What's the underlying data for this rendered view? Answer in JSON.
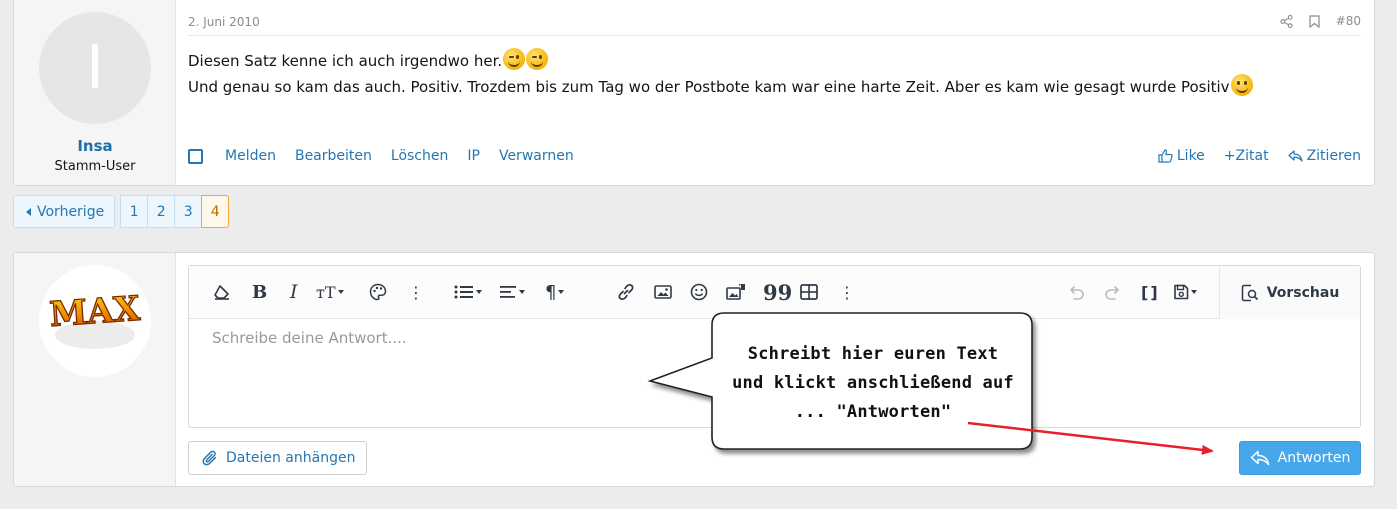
{
  "post": {
    "avatar_letter": "I",
    "username": "Insa",
    "user_title": "Stamm-User",
    "date": "2. Juni 2010",
    "number": "#80",
    "body_line1": "Diesen Satz kenne ich auch irgendwo her.",
    "body_line2": "Und genau so kam das auch. Positiv. Trozdem bis zum Tag wo der Postbote kam war eine harte Zeit. Aber es kam wie gesagt wurde Positiv",
    "actions": [
      "Melden",
      "Bearbeiten",
      "Löschen",
      "IP",
      "Verwarnen"
    ],
    "like_label": "Like",
    "quote_label": "+Zitat",
    "reply_quote_label": "Zitieren"
  },
  "pagination": {
    "prev_label": "Vorherige",
    "pages": [
      "1",
      "2",
      "3",
      "4"
    ],
    "current_page": "4"
  },
  "reply": {
    "avatar_text": "MAX",
    "placeholder": "Schreibe deine Antwort....",
    "preview_label": "Vorschau",
    "attach_label": "Dateien anhängen",
    "submit_label": "Antworten"
  },
  "callout": {
    "line1": "Schreibt hier euren Text",
    "line2": "und klickt anschließend auf",
    "line3": "... \"Antworten\""
  },
  "colors": {
    "link": "#2577b1",
    "submit_bg": "#47a7eb",
    "current_page_border": "#f0a73e",
    "arrow": "#e8202a"
  }
}
